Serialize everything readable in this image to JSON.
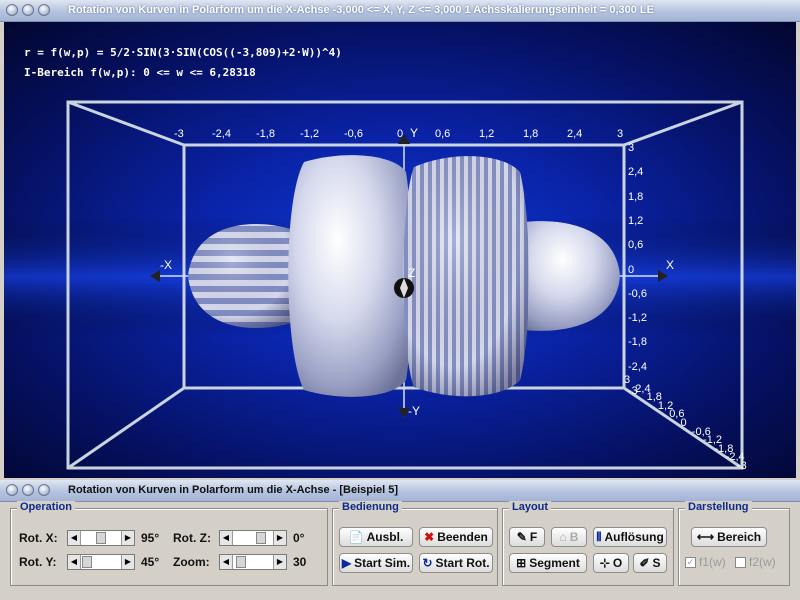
{
  "window": {
    "title": "Rotation von Kurven in Polarform um die X-Achse   -3,000 <= X, Y, Z <= 3,000    1 Achsskalierungseinheit = 0,300 LE"
  },
  "formula": {
    "line1": "r = f(w,p) = 5/2·SIN(3·SIN(COS((-3,809)+2·W))^4)",
    "line2": "I-Bereich f(w,p): 0 <= w <= 6,28318"
  },
  "axes": {
    "top_ticks": [
      "-3",
      "-2,4",
      "-1,8",
      "-1,2",
      "-0,6",
      "0",
      "0,6",
      "1,2",
      "1,8",
      "2,4",
      "3"
    ],
    "right_ticks": [
      "3",
      "2,4",
      "1,8",
      "1,2",
      "0,6",
      "0",
      "-0,6",
      "-1,2",
      "-1,8",
      "-2,4",
      "-3"
    ],
    "diag_ticks": [
      "3",
      "2,4",
      "1,8",
      "1,2",
      "0,6",
      "0",
      "-0,6",
      "-1,2",
      "-1,8",
      "-2,4",
      "-3"
    ],
    "labels": {
      "x_pos": "X",
      "x_neg": "-X",
      "y_pos": "Y",
      "y_neg": "-Y",
      "z": "Z"
    }
  },
  "subwindow": {
    "title": "Rotation von Kurven in Polarform um die X-Achse - [Beispiel 5]"
  },
  "operation": {
    "title": "Operation",
    "rot_x_label": "Rot. X:",
    "rot_x_value": "95°",
    "rot_y_label": "Rot. Y:",
    "rot_y_value": "45°",
    "rot_z_label": "Rot. Z:",
    "rot_z_value": "0°",
    "zoom_label": "Zoom:",
    "zoom_value": "30"
  },
  "bedienung": {
    "title": "Bedienung",
    "ausbl": "Ausbl.",
    "beenden": "Beenden",
    "start_sim": "Start Sim.",
    "start_rot": "Start Rot."
  },
  "layout": {
    "title": "Layout",
    "f_btn": "F",
    "b_btn": "B",
    "aufloesung": "Auflösung",
    "segment": "Segment",
    "o_btn": "O",
    "s_btn": "S"
  },
  "darstellung": {
    "title": "Darstellung",
    "bereich": "Bereich",
    "f1": "f1(w)",
    "f2": "f2(w)"
  },
  "colors": {
    "accent": "#0b2a8a",
    "background_blue": "#0a1f8f",
    "surface": "#c8cde0"
  }
}
